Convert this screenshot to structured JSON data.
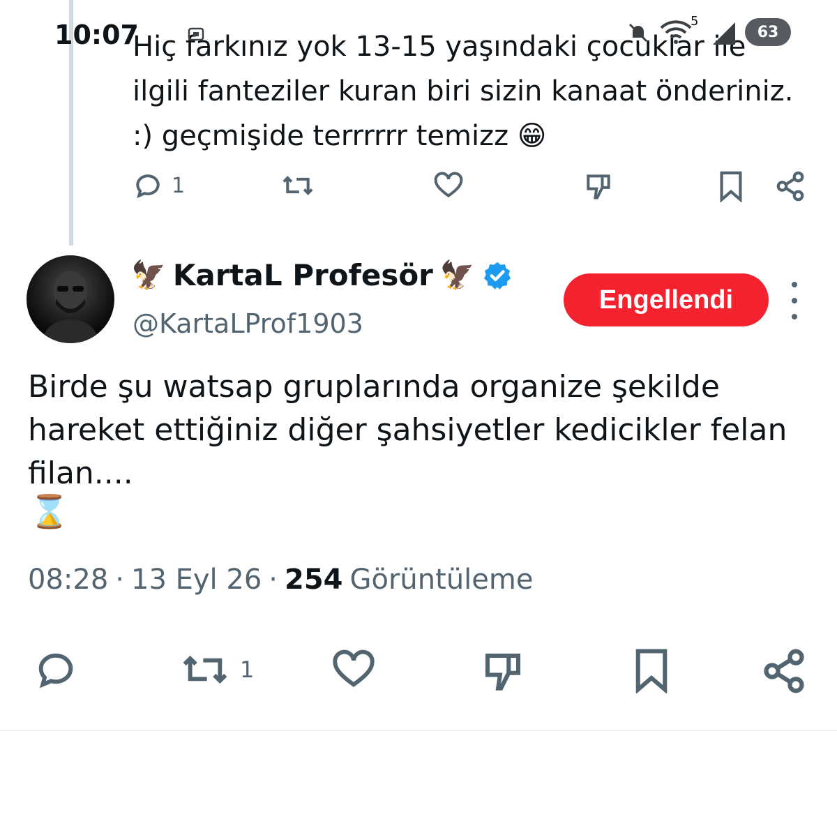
{
  "status_bar": {
    "time": "10:07",
    "wifi_label": "5",
    "battery": "63"
  },
  "top_tweet": {
    "text": "Hiç farkınız yok 13-15 yaşındaki çocuklar ile ilgili fanteziler kuran biri sizin kanaat önderiniz. :) geçmişide terrrrrr temizz",
    "emoji": "😁",
    "reply_count": "1"
  },
  "main_tweet": {
    "author_name": "KartaL Profesör",
    "name_emoji": "🦅",
    "handle": "@KartaLProf1903",
    "blocked_label": "Engellendi",
    "text": "Birde şu watsap gruplarında organize şekilde hareket ettiğiniz diğer şahsiyetler kedicikler felan filan....",
    "hourglass": "⌛",
    "time": "08:28",
    "date": "13 Eyl 26",
    "view_count": "254",
    "views_label": "Görüntüleme",
    "retweet_count": "1"
  },
  "colors": {
    "accent_red": "#f4212e",
    "verified_blue": "#1d9bf0",
    "secondary_text": "#536471"
  }
}
